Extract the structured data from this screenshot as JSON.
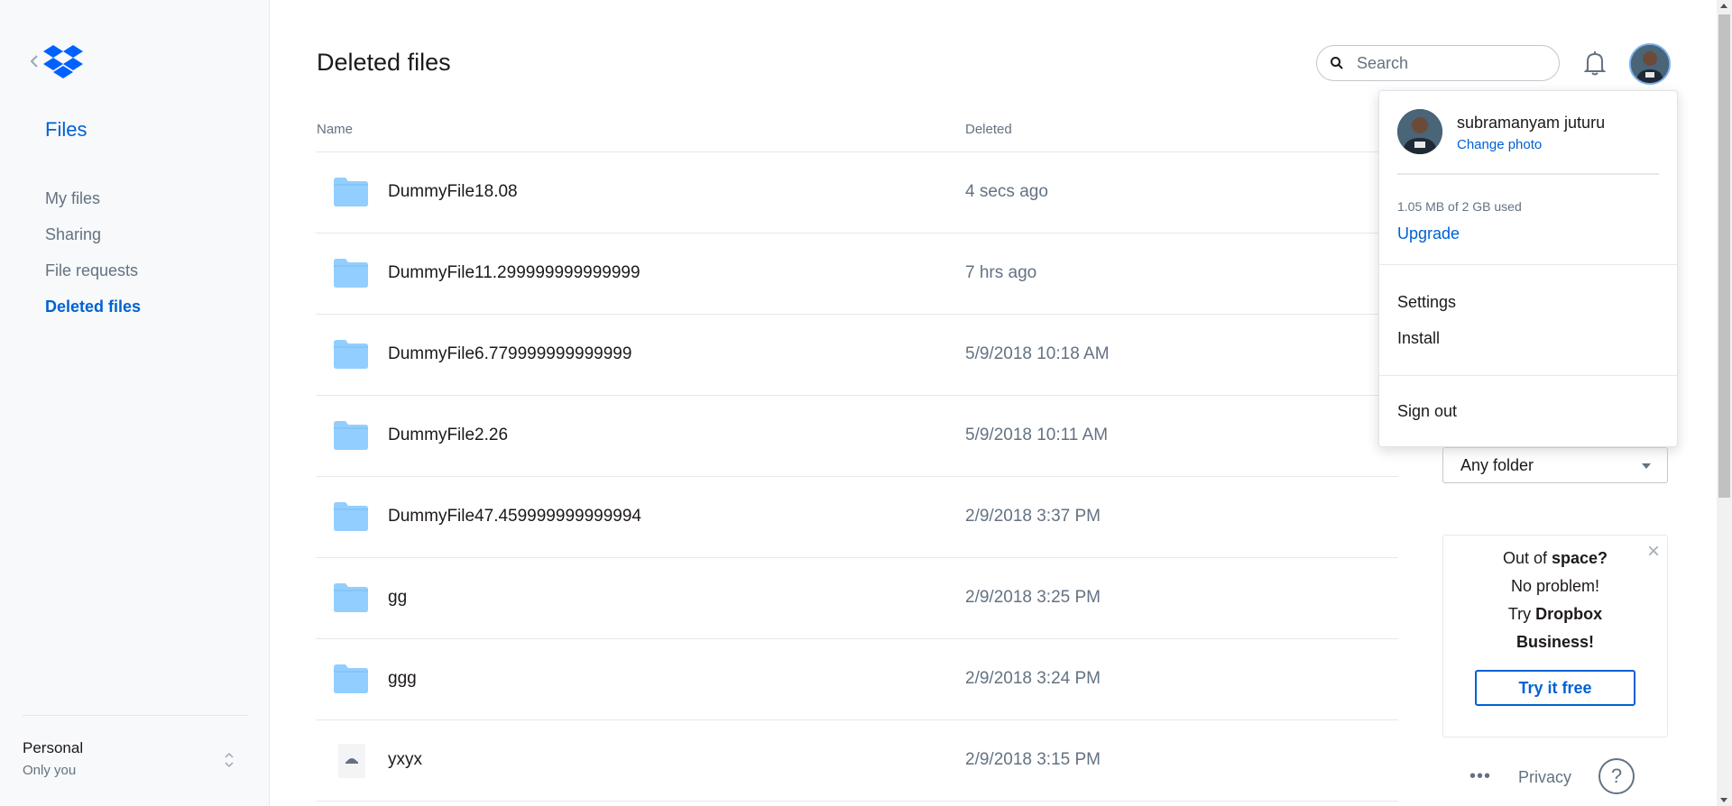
{
  "sidebar": {
    "title": "Files",
    "items": [
      {
        "label": "My files"
      },
      {
        "label": "Sharing"
      },
      {
        "label": "File requests"
      },
      {
        "label": "Deleted files",
        "active": true
      }
    ],
    "account": {
      "name": "Personal",
      "subtitle": "Only you"
    }
  },
  "header": {
    "title": "Deleted files",
    "search_placeholder": "Search"
  },
  "table": {
    "columns": [
      "Name",
      "Deleted"
    ],
    "rows": [
      {
        "name": "DummyFile18.08",
        "deleted": "4 secs ago",
        "icon": "folder-icon"
      },
      {
        "name": "DummyFile11.299999999999999",
        "deleted": "7 hrs ago",
        "icon": "folder-icon"
      },
      {
        "name": "DummyFile6.779999999999999",
        "deleted": "5/9/2018 10:18 AM",
        "icon": "folder-icon"
      },
      {
        "name": "DummyFile2.26",
        "deleted": "5/9/2018 10:11 AM",
        "icon": "folder-icon"
      },
      {
        "name": "DummyFile47.459999999999994",
        "deleted": "2/9/2018 3:37 PM",
        "icon": "folder-icon"
      },
      {
        "name": "gg",
        "deleted": "2/9/2018 3:25 PM",
        "icon": "folder-icon"
      },
      {
        "name": "ggg",
        "deleted": "2/9/2018 3:24 PM",
        "icon": "folder-icon"
      },
      {
        "name": "yxyx",
        "deleted": "2/9/2018 3:15 PM",
        "icon": "file-icon"
      }
    ]
  },
  "account_menu": {
    "name": "subramanyam juturu",
    "change_photo": "Change photo",
    "usage": "1.05 MB of 2 GB used",
    "upgrade": "Upgrade",
    "settings": "Settings",
    "install": "Install",
    "sign_out": "Sign out"
  },
  "filter": {
    "selected": "Any folder"
  },
  "promo": {
    "line1_prefix": "Out of ",
    "line1_bold": "space?",
    "line2": "No problem!",
    "line3_prefix": "Try ",
    "line3_bold": "Dropbox Business!",
    "button": "Try it free"
  },
  "footer": {
    "more": "•••",
    "privacy": "Privacy",
    "help": "?"
  },
  "colors": {
    "accent": "#0061d5",
    "folder": "#92ceff",
    "muted": "#637282"
  }
}
